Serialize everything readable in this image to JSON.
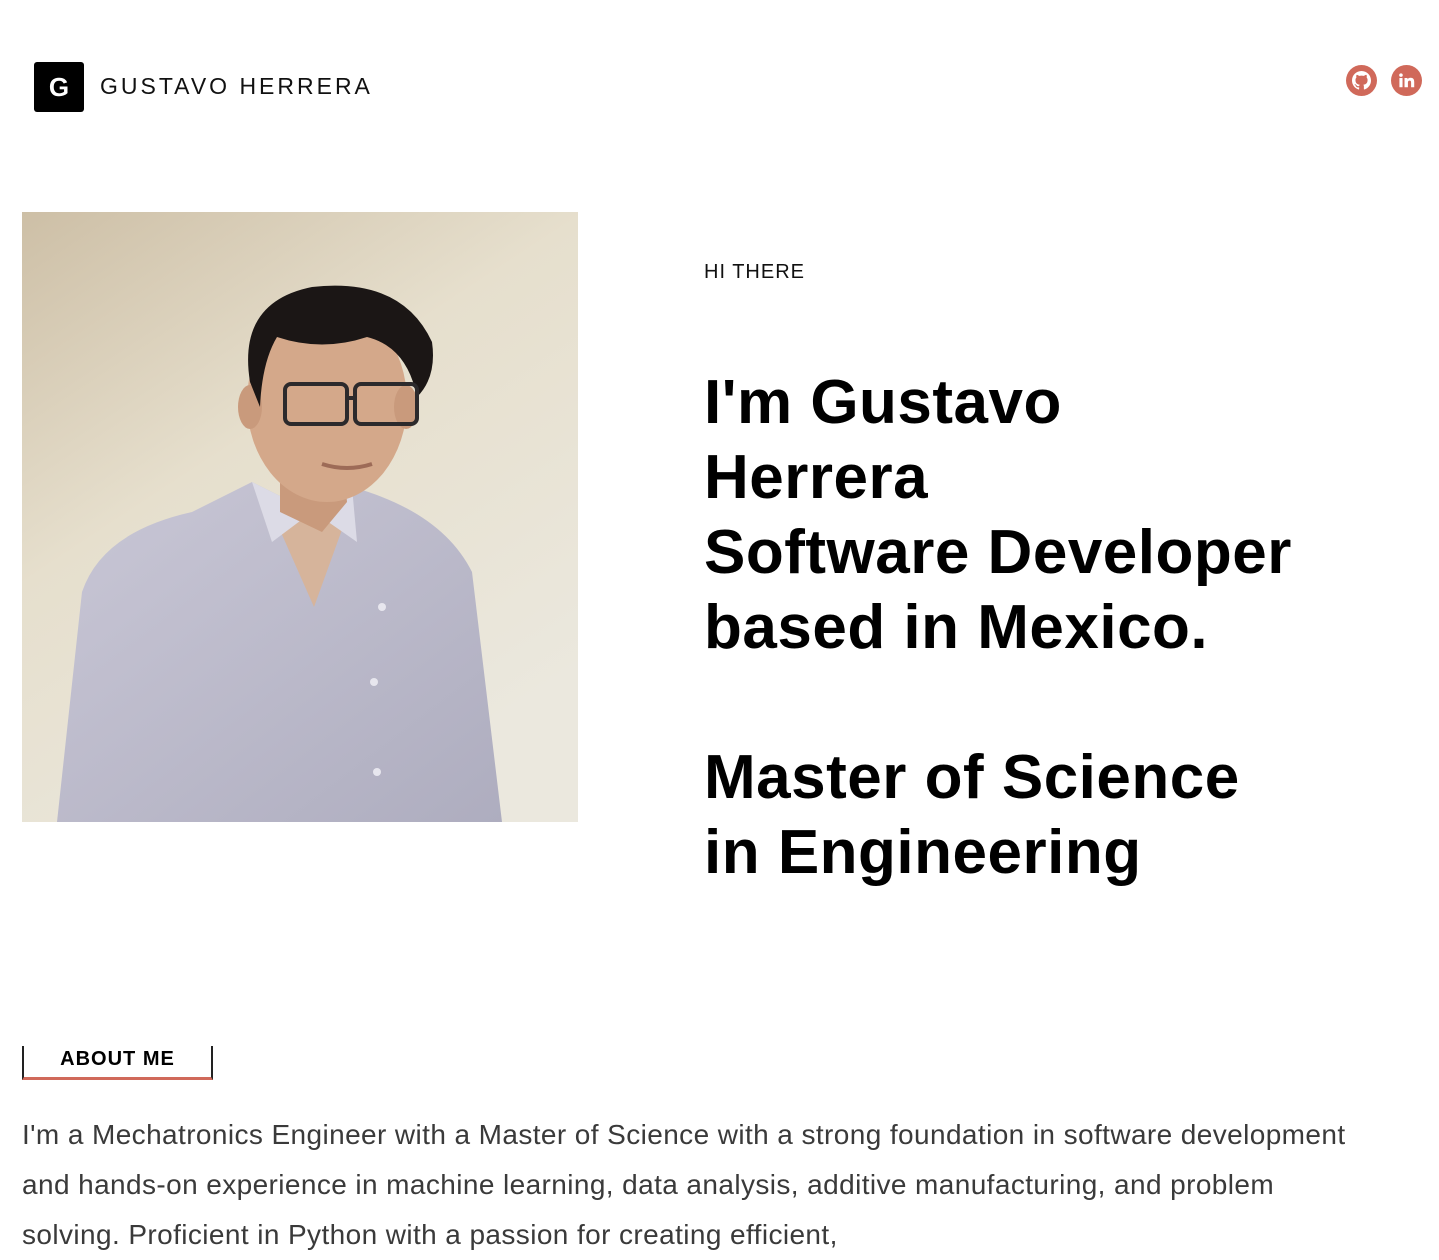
{
  "header": {
    "logo_letter": "G",
    "site_name": "GUSTAVO HERRERA",
    "social": [
      {
        "name": "GitHub",
        "icon": "github-icon"
      },
      {
        "name": "LinkedIn",
        "icon": "linkedin-icon"
      }
    ]
  },
  "hero": {
    "eyebrow": "HI THERE",
    "lines": [
      "I'm Gustavo",
      "Herrera",
      "Software Developer",
      "based in Mexico.",
      "",
      "Master of Science",
      "in Engineering"
    ]
  },
  "about": {
    "tab_label": "ABOUT ME",
    "text": "I'm a Mechatronics Engineer with a Master of Science with a strong foundation in software development and hands-on experience in machine learning, data analysis, additive manufacturing, and problem solving. Proficient in Python with a passion for creating efficient,"
  },
  "colors": {
    "accent": "#d0695a",
    "text": "#000000",
    "body_text": "#3a3a3a",
    "background": "#ffffff"
  }
}
